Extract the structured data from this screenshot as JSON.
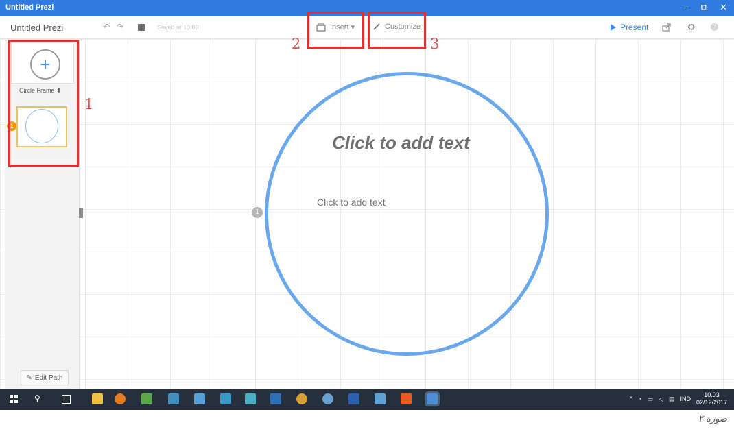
{
  "window": {
    "title": "Untitled Prezi",
    "controls": [
      "–",
      "⧉",
      "✕"
    ]
  },
  "toolbar": {
    "app_title": "Untitled Prezi",
    "saved_label": "Saved at 10:03",
    "insert_label": "Insert ▾",
    "customize_label": "Customize",
    "present_label": "Present"
  },
  "sidebar": {
    "frame_type": "Circle Frame  ⬍",
    "thumbnail_number": "1",
    "edit_path_label": "Edit Path"
  },
  "canvas": {
    "title_placeholder": "Click to add text",
    "body_placeholder": "Click to add text",
    "path_number": "1"
  },
  "annotations": {
    "one": "1",
    "two": "2",
    "three": "3"
  },
  "taskbar": {
    "language": "IND",
    "time": "10.03",
    "date": "02/12/2017"
  },
  "caption": "صورة ٣",
  "colors": {
    "titlebar": "#2f7be0",
    "circle": "#69a8ec",
    "annotation": "#e03030",
    "present": "#3a86f0"
  }
}
